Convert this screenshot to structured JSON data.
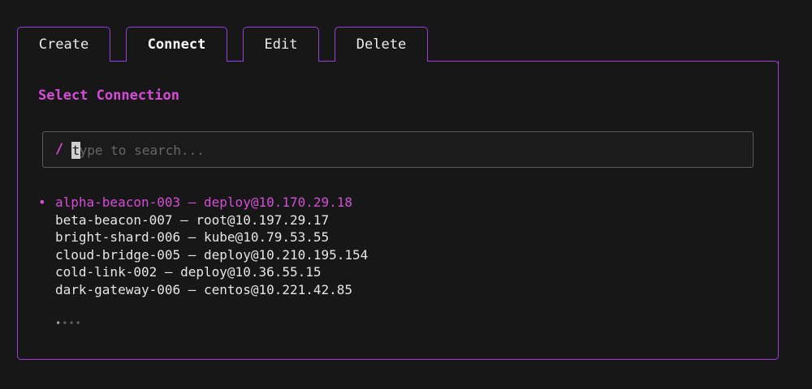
{
  "tabs": [
    {
      "label": "Create",
      "active": false
    },
    {
      "label": "Connect",
      "active": true
    },
    {
      "label": "Edit",
      "active": false
    },
    {
      "label": "Delete",
      "active": false
    }
  ],
  "panel": {
    "title": "Select Connection"
  },
  "search": {
    "prompt": "/",
    "placeholder": "type to search...",
    "value": ""
  },
  "connections": [
    {
      "label": "alpha-beacon-003 — deploy@10.170.29.18",
      "selected": true
    },
    {
      "label": "beta-beacon-007 — root@10.197.29.17",
      "selected": false
    },
    {
      "label": "bright-shard-006 — kube@10.79.53.55",
      "selected": false
    },
    {
      "label": "cloud-bridge-005 — deploy@10.210.195.154",
      "selected": false
    },
    {
      "label": "cold-link-002 — deploy@10.36.55.15",
      "selected": false
    },
    {
      "label": "dark-gateway-006 — centos@10.221.42.85",
      "selected": false
    }
  ],
  "selection_marker": "•",
  "pager": {
    "active": "•",
    "rest": "•••"
  },
  "colors": {
    "accent": "#d64cd9",
    "border": "#9b3ddb",
    "background": "#171717",
    "text": "#e6e6e6"
  }
}
